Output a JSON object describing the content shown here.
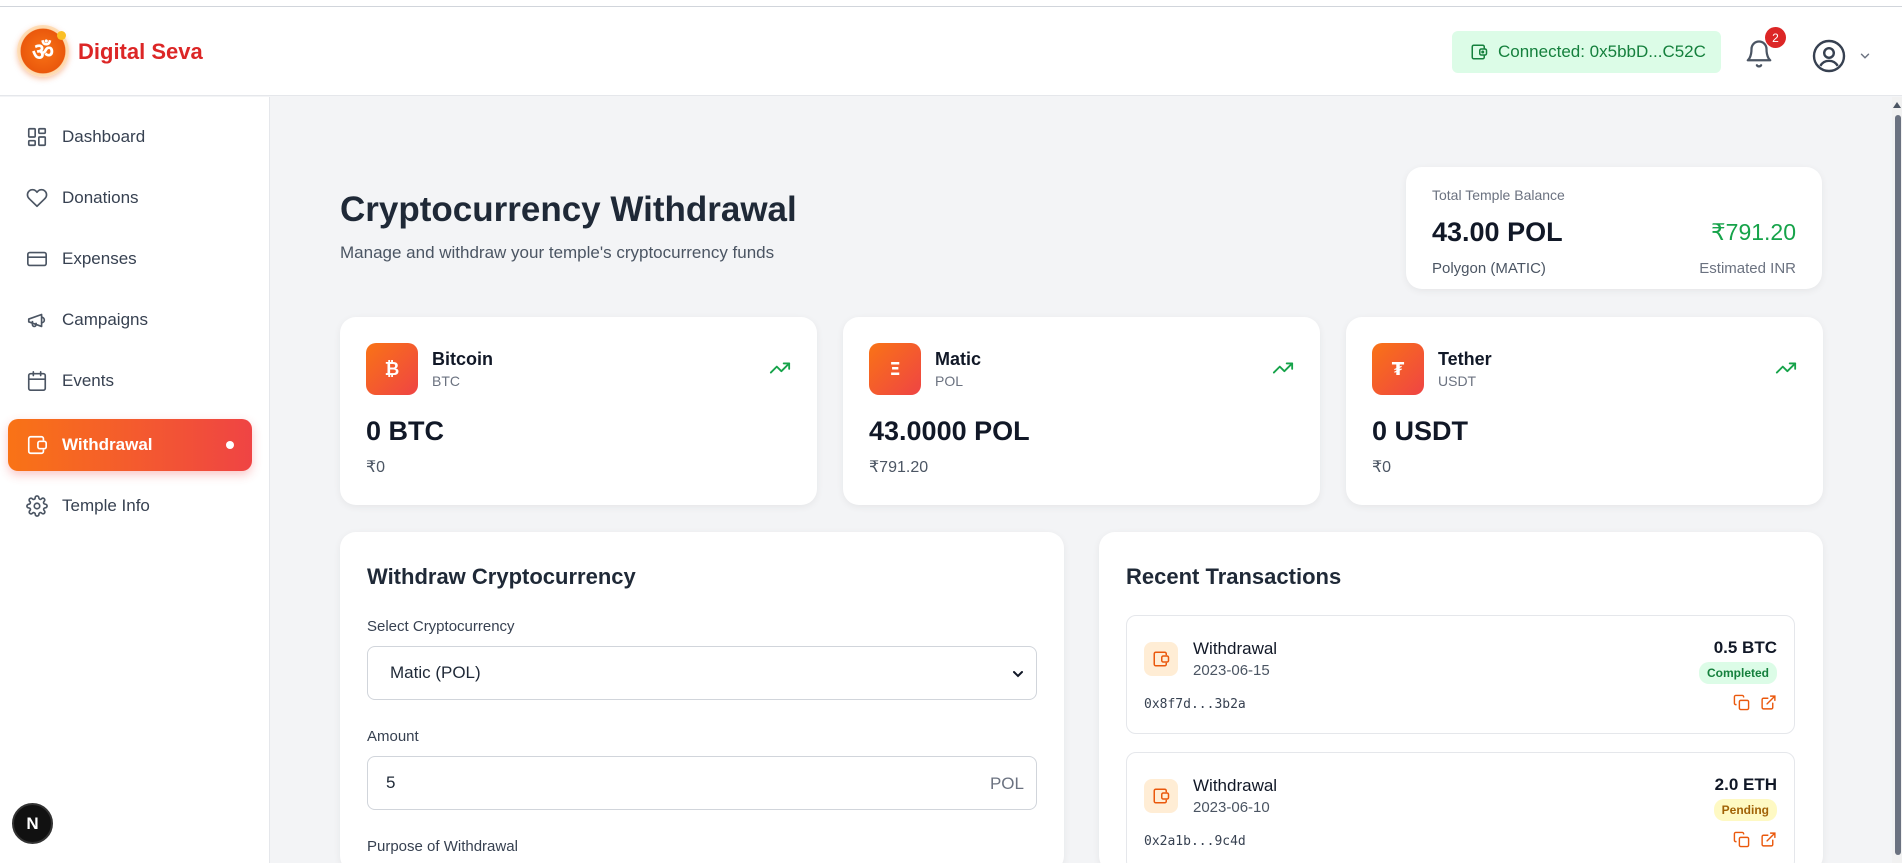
{
  "header": {
    "brand": "Digital Seva",
    "logo_glyph": "ॐ",
    "wallet_status": "Connected: 0x5bbD...C52C",
    "notification_count": "2"
  },
  "sidebar": {
    "items": [
      {
        "label": "Dashboard",
        "icon": "grid-icon"
      },
      {
        "label": "Donations",
        "icon": "heart-icon"
      },
      {
        "label": "Expenses",
        "icon": "credit-card-icon"
      },
      {
        "label": "Campaigns",
        "icon": "megaphone-icon"
      },
      {
        "label": "Events",
        "icon": "calendar-icon"
      },
      {
        "label": "Withdrawal",
        "icon": "wallet-icon",
        "active": true
      },
      {
        "label": "Temple Info",
        "icon": "gear-icon"
      }
    ],
    "footer_badge": "N"
  },
  "page": {
    "title": "Cryptocurrency Withdrawal",
    "subtitle": "Manage and withdraw your temple's cryptocurrency funds"
  },
  "balance": {
    "label": "Total Temple Balance",
    "amount": "43.00 POL",
    "network": "Polygon (MATIC)",
    "inr": "₹791.20",
    "inr_label": "Estimated INR"
  },
  "coins": [
    {
      "name": "Bitcoin",
      "symbol": "BTC",
      "glyph": "₿",
      "balance": "0 BTC",
      "inr": "₹0"
    },
    {
      "name": "Matic",
      "symbol": "POL",
      "glyph": "Ξ",
      "balance": "43.0000 POL",
      "inr": "₹791.20"
    },
    {
      "name": "Tether",
      "symbol": "USDT",
      "glyph": "₮",
      "balance": "0 USDT",
      "inr": "₹0"
    }
  ],
  "withdraw": {
    "title": "Withdraw Cryptocurrency",
    "select_label": "Select Cryptocurrency",
    "selected": "Matic (POL)",
    "amount_label": "Amount",
    "amount_value": "5",
    "amount_unit": "POL",
    "purpose_label": "Purpose of Withdrawal"
  },
  "transactions": {
    "title": "Recent Transactions",
    "items": [
      {
        "type": "Withdrawal",
        "date": "2023-06-15",
        "hash": "0x8f7d...3b2a",
        "amount": "0.5 BTC",
        "status": "Completed"
      },
      {
        "type": "Withdrawal",
        "date": "2023-06-10",
        "hash": "0x2a1b...9c4d",
        "amount": "2.0 ETH",
        "status": "Pending"
      }
    ]
  },
  "colors": {
    "accent_start": "#f97316",
    "accent_end": "#ef4444",
    "success": "#16a34a",
    "pending": "#a16207"
  }
}
